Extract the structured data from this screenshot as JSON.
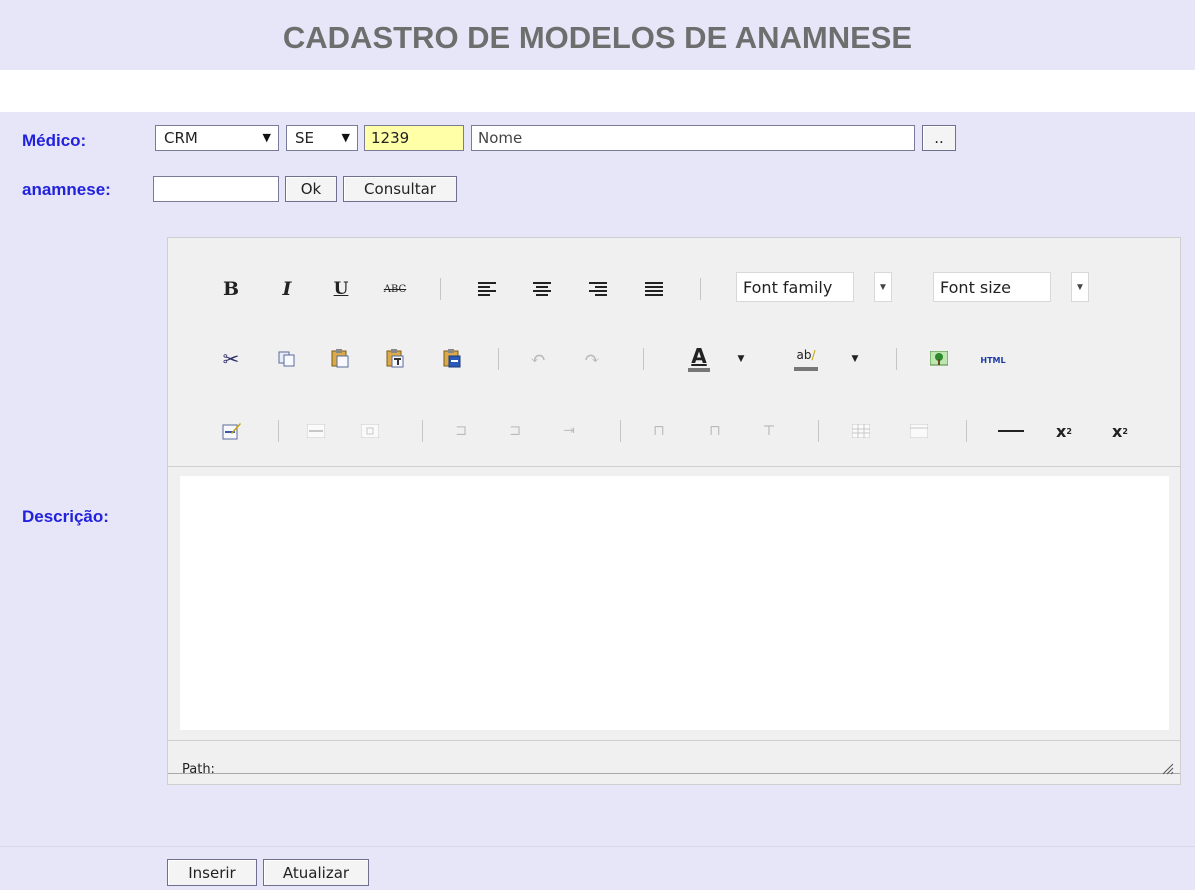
{
  "title": "CADASTRO DE MODELOS DE ANAMNESE",
  "form": {
    "medico_label": "Médico:",
    "crm_type": "CRM",
    "uf": "SE",
    "crm_number": "1239",
    "name_placeholder": "Nome",
    "lookup_button": "..",
    "anamnese_label": "anamnese:",
    "anamnese_value": "",
    "ok_button": "Ok",
    "consultar_button": "Consultar",
    "descricao_label": "Descrição:"
  },
  "editor": {
    "font_family": "Font family",
    "font_size": "Font size",
    "path_label": "Path:",
    "html_button": "HTML"
  },
  "actions": {
    "inserir": "Inserir",
    "atualizar": "Atualizar"
  },
  "colors": {
    "label": "#2222dd",
    "panel": "#e6e6f8",
    "crm_highlight": "#ffffa8"
  }
}
